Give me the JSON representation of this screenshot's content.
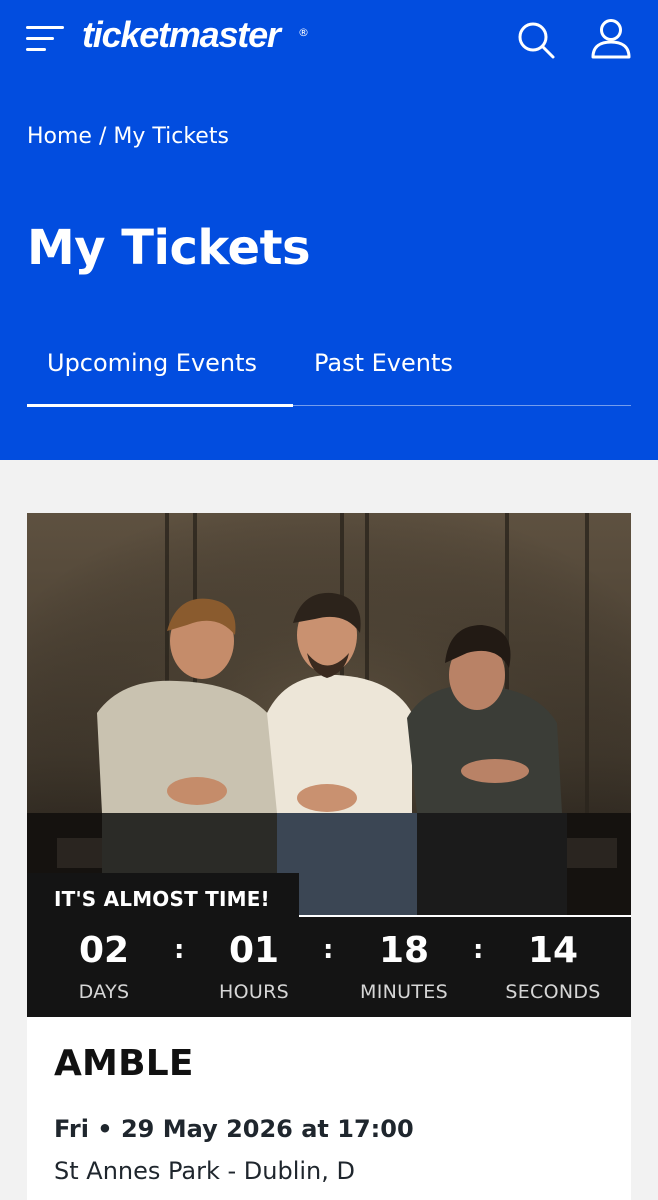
{
  "header": {
    "logo_text": "ticketmaster",
    "logo_mark": "®",
    "menu_icon": "hamburger-menu-icon",
    "search_icon": "search-icon",
    "account_icon": "user-icon",
    "brand_color": "#024ddf"
  },
  "breadcrumb": {
    "home": "Home",
    "separator": " / ",
    "current": "My Tickets"
  },
  "page": {
    "title": "My Tickets"
  },
  "tabs": [
    {
      "label": "Upcoming Events",
      "active": true
    },
    {
      "label": "Past Events",
      "active": false
    }
  ],
  "event": {
    "banner": "IT'S ALMOST TIME!",
    "countdown": [
      {
        "value": "02",
        "label": "DAYS"
      },
      {
        "value": "01",
        "label": "HOURS"
      },
      {
        "value": "18",
        "label": "MINUTES"
      },
      {
        "value": "14",
        "label": "SECONDS"
      }
    ],
    "separator": ":",
    "name": "AMBLE",
    "date": "Fri • 29 May 2026 at 17:00",
    "venue": "St Annes Park - Dublin, D"
  }
}
